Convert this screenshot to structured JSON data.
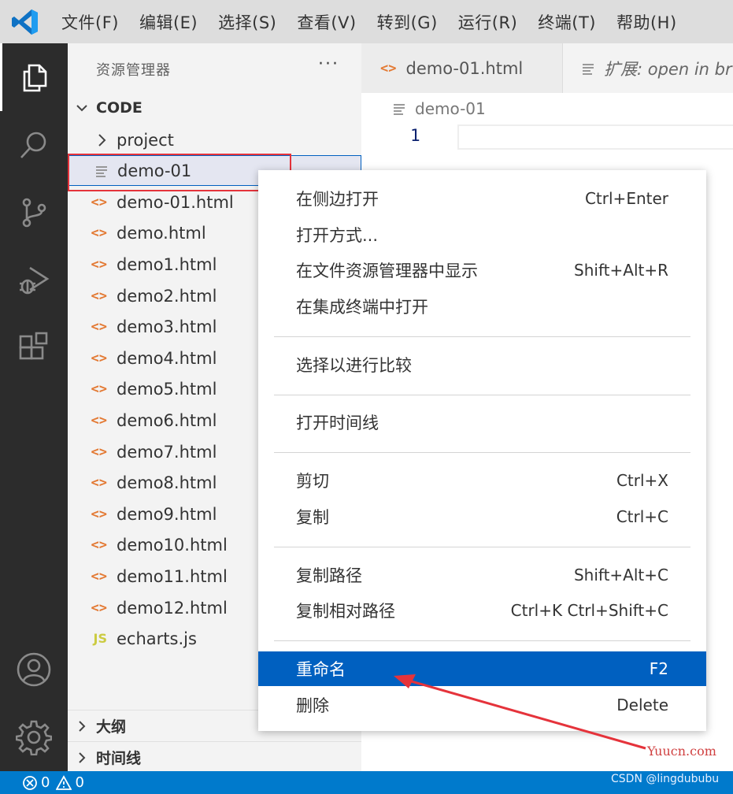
{
  "menubar": {
    "items": [
      "文件(F)",
      "编辑(E)",
      "选择(S)",
      "查看(V)",
      "转到(G)",
      "运行(R)",
      "终端(T)",
      "帮助(H)"
    ]
  },
  "activity_bar": {
    "items": [
      "explorer-icon",
      "search-icon",
      "source-control-icon",
      "run-debug-icon",
      "extensions-icon"
    ],
    "bottom": [
      "account-icon",
      "settings-gear-icon"
    ]
  },
  "sidebar": {
    "title": "资源管理器",
    "more": "···",
    "section": "CODE",
    "files": [
      {
        "name": "project",
        "kind": "folder"
      },
      {
        "name": "demo-01",
        "kind": "text"
      },
      {
        "name": "demo-01.html",
        "kind": "html"
      },
      {
        "name": "demo.html",
        "kind": "html"
      },
      {
        "name": "demo1.html",
        "kind": "html"
      },
      {
        "name": "demo2.html",
        "kind": "html"
      },
      {
        "name": "demo3.html",
        "kind": "html"
      },
      {
        "name": "demo4.html",
        "kind": "html"
      },
      {
        "name": "demo5.html",
        "kind": "html"
      },
      {
        "name": "demo6.html",
        "kind": "html"
      },
      {
        "name": "demo7.html",
        "kind": "html"
      },
      {
        "name": "demo8.html",
        "kind": "html"
      },
      {
        "name": "demo9.html",
        "kind": "html"
      },
      {
        "name": "demo10.html",
        "kind": "html"
      },
      {
        "name": "demo11.html",
        "kind": "html"
      },
      {
        "name": "demo12.html",
        "kind": "html"
      },
      {
        "name": "echarts.js",
        "kind": "js"
      }
    ],
    "html_glyph": "<>",
    "js_glyph": "JS",
    "outline_section": "大纲",
    "timeline_section": "时间线"
  },
  "editor": {
    "tabs": [
      {
        "label": "demo-01.html"
      },
      {
        "label": "扩展: open in br"
      }
    ],
    "breadcrumb": "demo-01",
    "line_number": "1"
  },
  "context_menu": {
    "items": [
      {
        "label": "在侧边打开",
        "shortcut": "Ctrl+Enter"
      },
      {
        "label": "打开方式...",
        "shortcut": ""
      },
      {
        "label": "在文件资源管理器中显示",
        "shortcut": "Shift+Alt+R"
      },
      {
        "label": "在集成终端中打开",
        "shortcut": ""
      },
      {
        "label": "选择以进行比较",
        "shortcut": ""
      },
      {
        "label": "打开时间线",
        "shortcut": ""
      },
      {
        "label": "剪切",
        "shortcut": "Ctrl+X"
      },
      {
        "label": "复制",
        "shortcut": "Ctrl+C"
      },
      {
        "label": "复制路径",
        "shortcut": "Shift+Alt+C"
      },
      {
        "label": "复制相对路径",
        "shortcut": "Ctrl+K Ctrl+Shift+C"
      },
      {
        "label": "重命名",
        "shortcut": "F2"
      },
      {
        "label": "删除",
        "shortcut": "Delete"
      }
    ],
    "highlighted": "重命名"
  },
  "statusbar": {
    "errors": "0",
    "warnings": "0"
  },
  "watermarks": {
    "site": "Yuucn.com",
    "author": "CSDN @lingdububu"
  },
  "colors": {
    "accent": "#007acc",
    "highlight": "#0060c0",
    "annotation_red": "#e5333b"
  }
}
